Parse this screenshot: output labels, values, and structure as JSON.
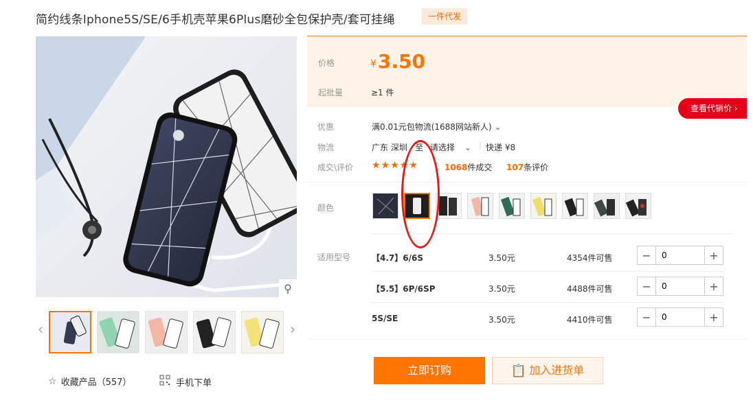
{
  "product": {
    "title": "简约线条Iphone5S/SE/6手机壳苹果6Plus磨砂全包保护壳/套可挂绳",
    "badge": "一件代发"
  },
  "gallery": {
    "favorite_label": "收藏产品（557）",
    "mobile_label": "手机下单"
  },
  "price_panel": {
    "price_label": "价格",
    "currency": "¥",
    "price": "3.50",
    "moq_label": "起批量",
    "moq_value": "≥1 件",
    "agent_button": "查看代销价 ›"
  },
  "info": {
    "promo_label": "优惠",
    "promo_value": "满0.01元包物流(1688网站新人)",
    "logistics_label": "物流",
    "logistics_from": "广东 深圳",
    "logistics_to": "至",
    "logistics_select": "请选择",
    "express": "快递 ¥8",
    "rating_label": "成交\\评价",
    "stars": "★★★★★",
    "deals_count": "1068",
    "deals_suffix": "件成交",
    "reviews_count": "107",
    "reviews_suffix": "条评价"
  },
  "color": {
    "label": "颜色",
    "selected_index": 1,
    "options": [
      "swatch-1",
      "swatch-2",
      "swatch-3",
      "swatch-4",
      "swatch-5",
      "swatch-6",
      "swatch-7",
      "swatch-8",
      "swatch-9"
    ]
  },
  "models": {
    "label": "适用型号",
    "rows": [
      {
        "name": "【4.7】6/6S",
        "price": "3.50元",
        "stock": "4354件可售",
        "qty": "0"
      },
      {
        "name": "【5.5】6P/6SP",
        "price": "3.50元",
        "stock": "4488件可售",
        "qty": "0"
      },
      {
        "name": "5S/SE",
        "price": "3.50元",
        "stock": "4410件可售",
        "qty": "0"
      }
    ]
  },
  "actions": {
    "buy": "立即订购",
    "cart": "加入进货单"
  },
  "colors": {
    "accent": "#ff7300",
    "price_bg": "#fff2e6",
    "agent_red": "#e6001a",
    "annotation": "#e61a1a"
  }
}
